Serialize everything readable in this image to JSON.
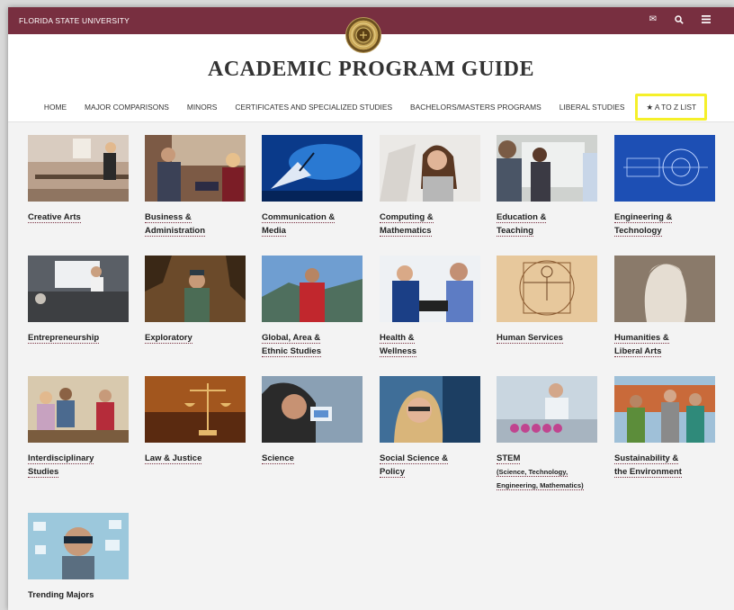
{
  "topbar": {
    "brand": "FLORIDA STATE UNIVERSITY",
    "icons": [
      "envelope-icon",
      "search-icon",
      "menu-icon"
    ]
  },
  "page_title": "ACADEMIC PROGRAM GUIDE",
  "nav": [
    "HOME",
    "MAJOR COMPARISONS",
    "MINORS",
    "CERTIFICATES AND SPECIALIZED STUDIES",
    "BACHELORS/MASTERS PROGRAMS",
    "LIBERAL STUDIES",
    "★ A TO Z LIST"
  ],
  "tiles": [
    {
      "line1": "Creative Arts",
      "line2": ""
    },
    {
      "line1": "Business &",
      "line2": "Administration"
    },
    {
      "line1": "Communication &",
      "line2": "Media"
    },
    {
      "line1": "Computing &",
      "line2": "Mathematics"
    },
    {
      "line1": "Education &",
      "line2": "Teaching"
    },
    {
      "line1": "Engineering &",
      "line2": "Technology"
    },
    {
      "line1": "Entrepreneurship",
      "line2": ""
    },
    {
      "line1": "Exploratory",
      "line2": ""
    },
    {
      "line1": "Global, Area &",
      "line2": "Ethnic Studies"
    },
    {
      "line1": "Health &",
      "line2": "Wellness"
    },
    {
      "line1": "Human Services",
      "line2": ""
    },
    {
      "line1": "Humanities &",
      "line2": "Liberal Arts"
    },
    {
      "line1": "Interdisciplinary",
      "line2": "Studies"
    },
    {
      "line1": "Law & Justice",
      "line2": ""
    },
    {
      "line1": "Science",
      "line2": ""
    },
    {
      "line1": "Social Science &",
      "line2": "Policy"
    },
    {
      "line1": "STEM",
      "line2": "(Science, Technology,",
      "line3": "Engineering, Mathematics)"
    },
    {
      "line1": "Sustainability &",
      "line2": "the Environment"
    },
    {
      "line1": "Trending Majors",
      "line2": ""
    }
  ],
  "colors": {
    "garnet": "#782f40",
    "highlight": "#f5f02a"
  }
}
